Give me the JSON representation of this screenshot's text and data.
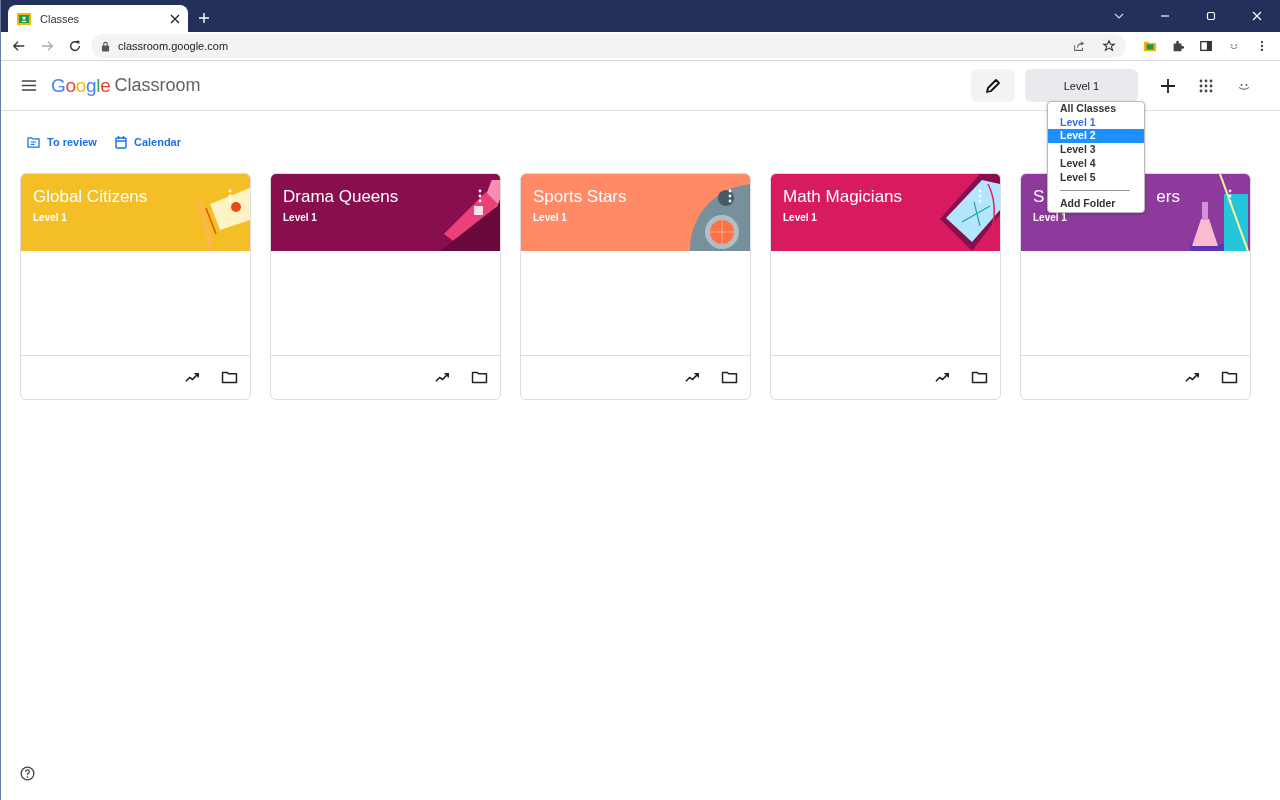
{
  "browser": {
    "tab_title": "Classes",
    "url": "classroom.google.com"
  },
  "header": {
    "logo_brand": "Google",
    "logo_product": "Classroom",
    "folder_button": "Level 1"
  },
  "links": [
    {
      "label": "To review",
      "kind": "review"
    },
    {
      "label": "Calendar",
      "kind": "calendar"
    }
  ],
  "classes": [
    {
      "title": "Global Citizens",
      "subtitle": "Level 1",
      "color": "#f4bf26"
    },
    {
      "title": "Drama Queens",
      "subtitle": "Level 1",
      "color": "#880e4f"
    },
    {
      "title": "Sports Stars",
      "subtitle": "Level 1",
      "color": "#ff8a65"
    },
    {
      "title": "Math Magicians",
      "subtitle": "Level 1",
      "color": "#d81b60"
    },
    {
      "title_parts": [
        "S",
        "ers"
      ],
      "subtitle": "Level 1",
      "color": "#8e3a9d"
    }
  ],
  "folder_menu": {
    "items": [
      {
        "label": "All Classes",
        "kind": "option",
        "selected": false,
        "highlighted": false
      },
      {
        "label": "Level 1",
        "kind": "option",
        "selected": true,
        "highlighted": false
      },
      {
        "label": "Level 2",
        "kind": "option",
        "selected": false,
        "highlighted": true
      },
      {
        "label": "Level 3",
        "kind": "option",
        "selected": false,
        "highlighted": false
      },
      {
        "label": "Level 4",
        "kind": "option",
        "selected": false,
        "highlighted": false
      },
      {
        "label": "Level 5",
        "kind": "option",
        "selected": false,
        "highlighted": false
      },
      {
        "label": "Add Folder",
        "kind": "action",
        "selected": false,
        "highlighted": false
      }
    ]
  }
}
